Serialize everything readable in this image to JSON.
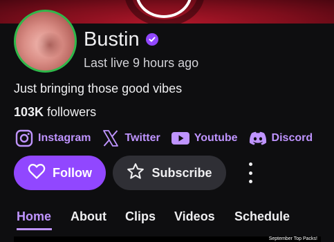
{
  "channel": {
    "name": "Bustin",
    "last_live": "Last live 9 hours ago",
    "bio": "Just bringing those good vibes",
    "followers_count": "103K",
    "followers_label": "followers"
  },
  "socials": [
    {
      "icon": "instagram-icon",
      "label": "Instagram"
    },
    {
      "icon": "x-twitter-icon",
      "label": "Twitter"
    },
    {
      "icon": "youtube-icon",
      "label": "Youtube"
    },
    {
      "icon": "discord-icon",
      "label": "Discord"
    }
  ],
  "actions": {
    "follow_label": "Follow",
    "subscribe_label": "Subscribe"
  },
  "tabs": [
    {
      "label": "Home",
      "active": true
    },
    {
      "label": "About",
      "active": false
    },
    {
      "label": "Clips",
      "active": false
    },
    {
      "label": "Videos",
      "active": false
    },
    {
      "label": "Schedule",
      "active": false
    }
  ],
  "preview": {
    "caption": "September Top Packs!"
  },
  "colors": {
    "accent": "#9147ff",
    "accent_light": "#bf94ff",
    "live_ring": "#2fb84a",
    "background": "#0e0e10"
  }
}
